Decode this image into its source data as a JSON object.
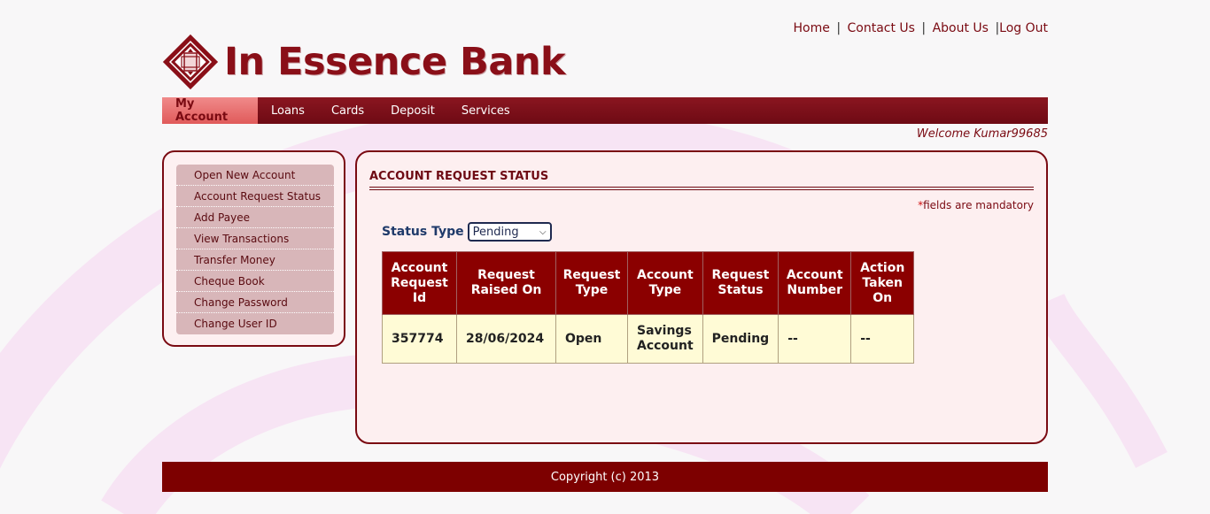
{
  "brand": {
    "name": "In Essence Bank"
  },
  "top_links": {
    "home": "Home",
    "contact": "Contact Us",
    "about": "About Us",
    "logout": "Log Out",
    "sep": "|"
  },
  "nav": {
    "items": [
      {
        "label": "My Account",
        "active": true
      },
      {
        "label": "Loans"
      },
      {
        "label": "Cards"
      },
      {
        "label": "Deposit"
      },
      {
        "label": "Services"
      }
    ]
  },
  "welcome": "Welcome Kumar99685",
  "sidebar": {
    "items": [
      {
        "label": "Open New Account"
      },
      {
        "label": "Account Request Status"
      },
      {
        "label": "Add Payee"
      },
      {
        "label": "View Transactions"
      },
      {
        "label": "Transfer Money"
      },
      {
        "label": "Cheque Book"
      },
      {
        "label": "Change Password"
      },
      {
        "label": "Change User ID"
      }
    ]
  },
  "main": {
    "title": "ACCOUNT REQUEST STATUS",
    "mandatory_star": "*",
    "mandatory_text": "fields are mandatory",
    "status_label": "Status Type",
    "status_value": "Pending",
    "table": {
      "headers": [
        "Account Request Id",
        "Request Raised On",
        "Request Type",
        "Account Type",
        "Request Status",
        "Account Number",
        "Action Taken On"
      ],
      "rows": [
        [
          "357774",
          "28/06/2024",
          "Open",
          "Savings Account",
          "Pending",
          "--",
          "--"
        ]
      ]
    }
  },
  "footer": {
    "copyright": "Copyright (c) 2013"
  },
  "colors": {
    "brand": "#8a0f18",
    "nav_bg": "#7a0f18",
    "nav_active": "#e86a6a",
    "table_header": "#8b0000",
    "table_cell": "#fffbd6",
    "footer_bg": "#7d0000"
  }
}
